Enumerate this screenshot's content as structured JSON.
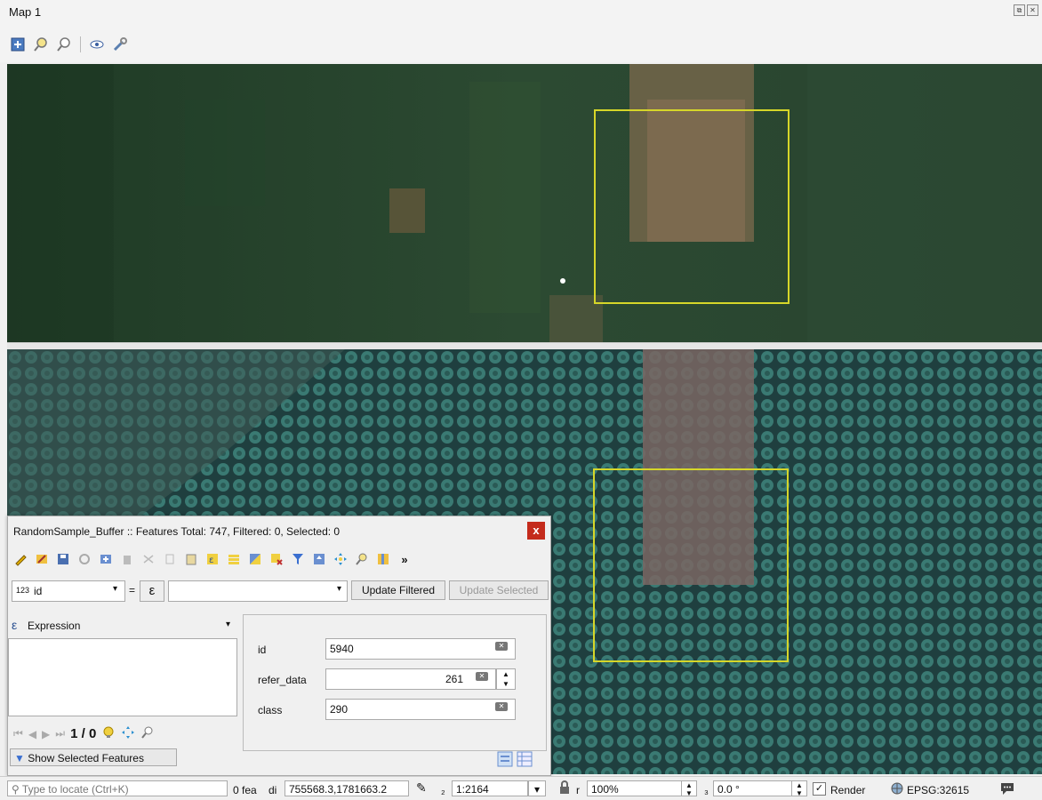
{
  "window": {
    "title": "Map 1"
  },
  "map_tools": [
    "zoom-full-icon",
    "zoom-layer-icon",
    "zoom-selection-icon",
    "visibility-icon",
    "settings-wrench-icon"
  ],
  "colors": {
    "sample_box": "#d6d629",
    "close_button": "#c42b1c",
    "canopy_dark": "#1f3f3f",
    "canopy_light": "#3a7a73"
  },
  "dialog": {
    "title": "RandomSample_Buffer :: Features Total: 747, Filtered: 0, Selected: 0",
    "close": "x",
    "field_select": {
      "type_label": "123",
      "value": "id"
    },
    "equals": "=",
    "epsilon": "ε",
    "update_filtered": "Update Filtered",
    "update_selected": "Update Selected",
    "expression_label": "Expression",
    "navigation": "1 / 0",
    "fields": [
      {
        "label": "id",
        "value": "5940"
      },
      {
        "label": "refer_data",
        "value": "261"
      },
      {
        "label": "class",
        "value": "290"
      }
    ],
    "show_features": "Show Selected Features"
  },
  "statusbar": {
    "locate_placeholder": "Type to locate (Ctrl+K)",
    "features_text": "0 fea",
    "coord_label": "di",
    "coordinates": "755568.3,1781663.2",
    "scale_label": "₂",
    "scale": "1:2164",
    "magnifier_label": "r",
    "magnifier": "100%",
    "rotation_label": "₃",
    "rotation": "0.0 °",
    "render_label": "Render",
    "crs": "EPSG:32615"
  }
}
